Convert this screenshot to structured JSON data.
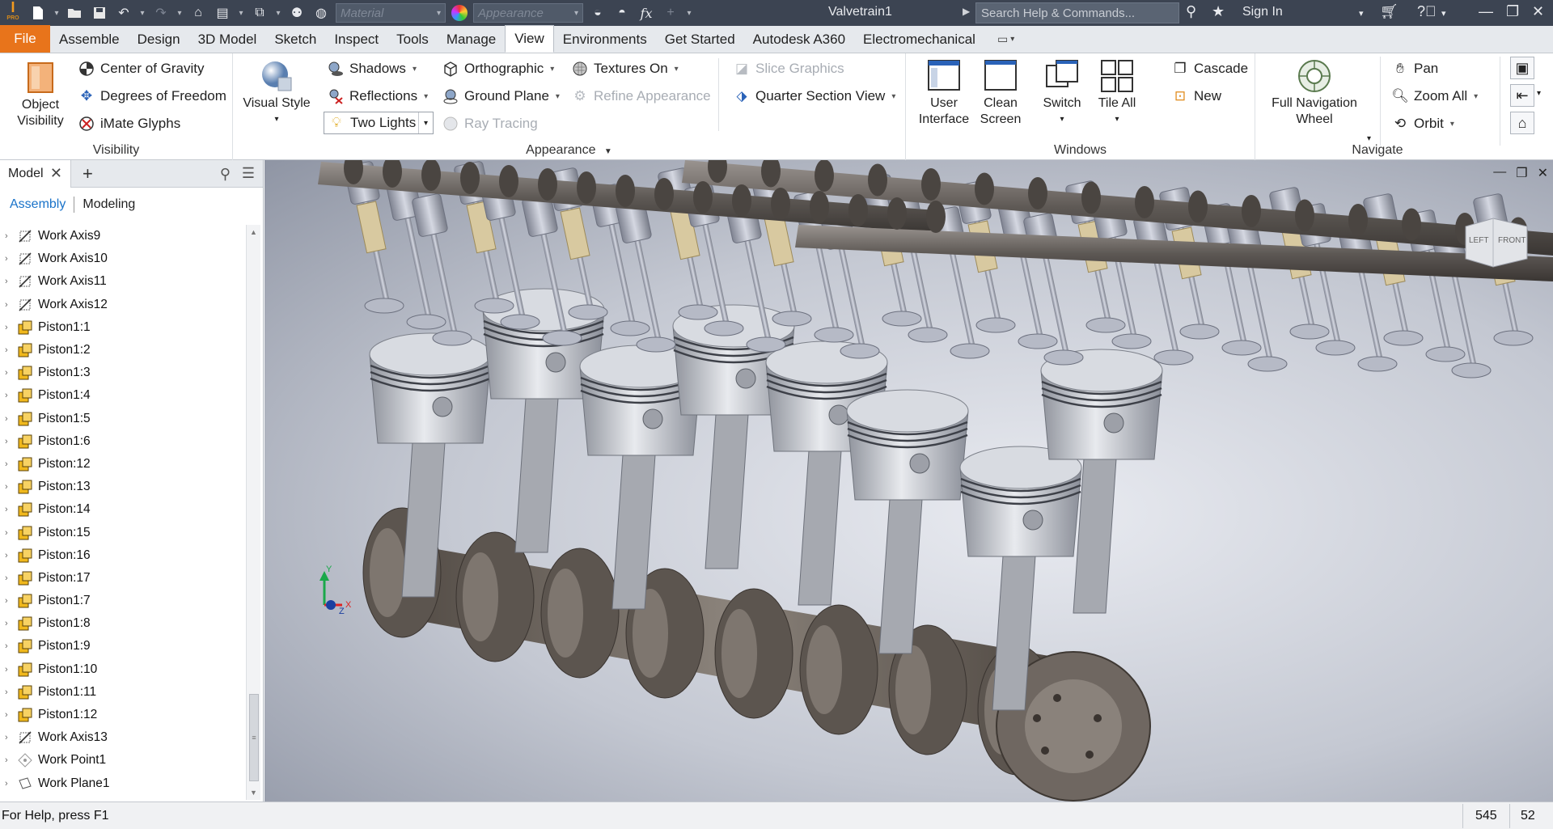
{
  "title_bar": {
    "app_logo": "I",
    "app_logo_sub": "PRO",
    "material_placeholder": "Material",
    "appearance_placeholder": "Appearance",
    "fx_label": "fx",
    "document_title": "Valvetrain1",
    "search_placeholder": "Search Help & Commands...",
    "sign_in": "Sign In"
  },
  "ribbon_tabs": [
    "File",
    "Assemble",
    "Design",
    "3D Model",
    "Sketch",
    "Inspect",
    "Tools",
    "Manage",
    "View",
    "Environments",
    "Get Started",
    "Autodesk A360",
    "Electromechanical"
  ],
  "ribbon_active_tab": "View",
  "ribbon": {
    "visibility": {
      "label": "Visibility",
      "object_visibility": "Object Visibility",
      "center_of_gravity": "Center of Gravity",
      "degrees_of_freedom": "Degrees of Freedom",
      "imate_glyphs": "iMate Glyphs"
    },
    "appearance": {
      "label": "Appearance",
      "visual_style": "Visual Style",
      "shadows": "Shadows",
      "reflections": "Reflections",
      "lighting": "Two Lights",
      "orthographic": "Orthographic",
      "ground_plane": "Ground Plane",
      "ray_tracing": "Ray Tracing",
      "textures_on": "Textures On",
      "refine_appearance": "Refine Appearance",
      "slice_graphics": "Slice Graphics",
      "quarter_section_view": "Quarter Section View"
    },
    "windows": {
      "label": "Windows",
      "user_interface": "User Interface",
      "clean_screen": "Clean Screen",
      "switch": "Switch",
      "tile_all": "Tile All",
      "cascade": "Cascade",
      "new": "New"
    },
    "navigate": {
      "label": "Navigate",
      "full_navigation_wheel": "Full Navigation Wheel",
      "pan": "Pan",
      "zoom_all": "Zoom All",
      "orbit": "Orbit"
    }
  },
  "browser": {
    "tab": "Model",
    "subtab_assembly": "Assembly",
    "subtab_modeling": "Modeling",
    "tree": [
      {
        "label": "Work Axis9",
        "icon": "work-axis"
      },
      {
        "label": "Work Axis10",
        "icon": "work-axis"
      },
      {
        "label": "Work Axis11",
        "icon": "work-axis"
      },
      {
        "label": "Work Axis12",
        "icon": "work-axis"
      },
      {
        "label": "Piston1:1",
        "icon": "part"
      },
      {
        "label": "Piston1:2",
        "icon": "part"
      },
      {
        "label": "Piston1:3",
        "icon": "part"
      },
      {
        "label": "Piston1:4",
        "icon": "part"
      },
      {
        "label": "Piston1:5",
        "icon": "part"
      },
      {
        "label": "Piston1:6",
        "icon": "part"
      },
      {
        "label": "Piston:12",
        "icon": "part"
      },
      {
        "label": "Piston:13",
        "icon": "part"
      },
      {
        "label": "Piston:14",
        "icon": "part"
      },
      {
        "label": "Piston:15",
        "icon": "part"
      },
      {
        "label": "Piston:16",
        "icon": "part"
      },
      {
        "label": "Piston:17",
        "icon": "part"
      },
      {
        "label": "Piston1:7",
        "icon": "part"
      },
      {
        "label": "Piston1:8",
        "icon": "part"
      },
      {
        "label": "Piston1:9",
        "icon": "part"
      },
      {
        "label": "Piston1:10",
        "icon": "part"
      },
      {
        "label": "Piston1:11",
        "icon": "part"
      },
      {
        "label": "Piston1:12",
        "icon": "part"
      },
      {
        "label": "Work Axis13",
        "icon": "work-axis"
      },
      {
        "label": "Work Point1",
        "icon": "work-point"
      },
      {
        "label": "Work Plane1",
        "icon": "work-plane"
      }
    ]
  },
  "viewport": {
    "viewcube_left": "LEFT",
    "viewcube_front": "FRONT",
    "triad_x": "X",
    "triad_y": "Y",
    "triad_z": "Z"
  },
  "status_bar": {
    "help_text": "For Help, press F1",
    "value_1": "545",
    "value_2": "52"
  },
  "colors": {
    "title_bar_bg": "#3c4452",
    "file_tab": "#e8741b",
    "accent_blue": "#1a73c9",
    "part_icon": "#f0b81c"
  }
}
